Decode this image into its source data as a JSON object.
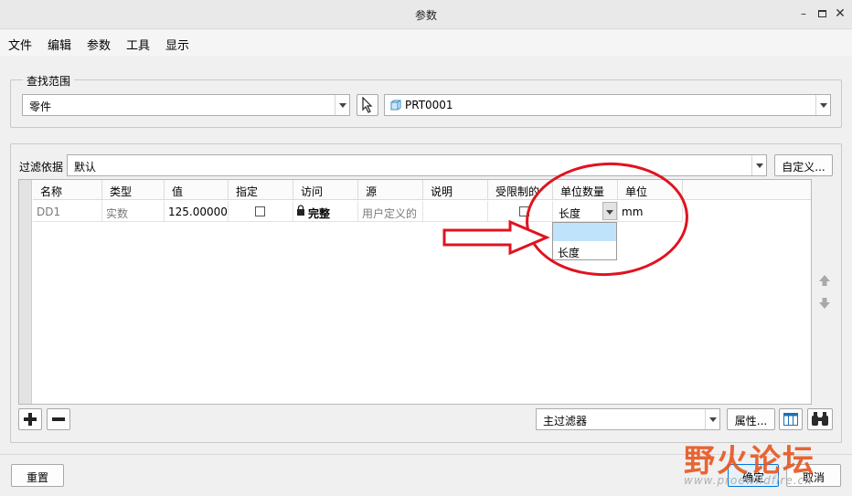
{
  "window": {
    "title": "参数"
  },
  "menu": [
    "文件",
    "编辑",
    "参数",
    "工具",
    "显示"
  ],
  "search_scope": {
    "label": "查找范围",
    "type_value": "零件",
    "model_value": "PRT0001"
  },
  "filter": {
    "label": "过滤依据",
    "value": "默认",
    "custom_button": "自定义..."
  },
  "table": {
    "headers": [
      "名称",
      "类型",
      "值",
      "指定",
      "访问",
      "源",
      "说明",
      "受限制的",
      "单位数量",
      "单位"
    ],
    "row": {
      "name": "DD1",
      "type": "实数",
      "value": "125.000000",
      "access": "完整",
      "source": "用户定义的",
      "unit_quantity": "长度",
      "unit": "mm"
    }
  },
  "unit_dropdown": {
    "options": [
      "",
      "长度"
    ]
  },
  "bottom": {
    "main_filter": "主过滤器",
    "properties_button": "属性..."
  },
  "footer": {
    "reset_button": "重置",
    "ok_button": "确定",
    "cancel_button": "取消"
  },
  "watermark": {
    "text": "野火论坛",
    "url": "www.proewildfire.cn"
  },
  "colors": {
    "annotation_red": "#e0131f",
    "selection_blue": "#bfe3fb",
    "watermark_orange": "#e8551e"
  },
  "icons": [
    "minimize-icon",
    "maximize-icon",
    "close-icon",
    "select-cursor-icon",
    "part-model-icon",
    "lock-icon",
    "add-icon",
    "remove-icon",
    "move-up-icon",
    "move-down-icon",
    "table-columns-icon",
    "binoculars-icon"
  ]
}
